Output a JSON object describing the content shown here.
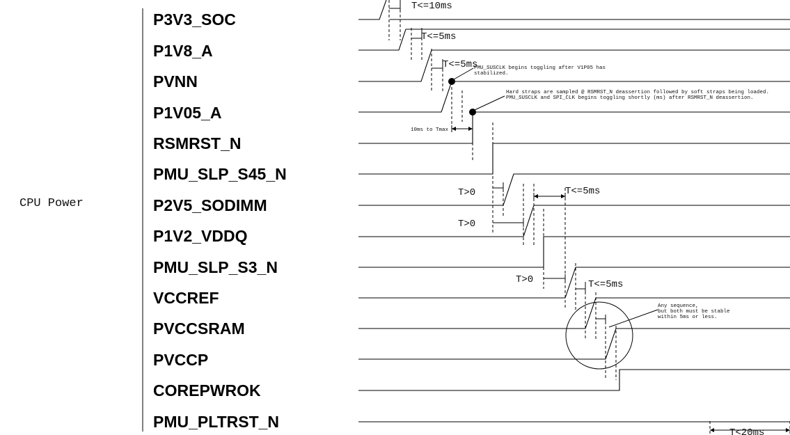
{
  "group_label": "CPU Power",
  "signals": [
    "P3V3_SOC",
    "P1V8_A",
    "PVNN",
    "P1V05_A",
    "RSMRST_N",
    "PMU_SLP_S45_N",
    "P2V5_SODIMM",
    "P1V2_VDDQ",
    "PMU_SLP_S3_N",
    "VCCREF",
    "PVCCSRAM",
    "PVCCP",
    "COREPWROK",
    "PMU_PLTRST_N"
  ],
  "timing_labels": {
    "t1": "T<=10ms",
    "t2": "T<=5ms",
    "t3": "T<=5ms",
    "t4": "10ms to Tmax",
    "t5": "T>0",
    "t6": "T<=5ms",
    "t7": "T>0",
    "t8": "T>0",
    "t9": "T<=5ms",
    "t10": "T<20ms"
  },
  "annotations": {
    "susclk_1": "PMU_SUSCLK begins toggling after V1P05 has",
    "susclk_2": "stabilized.",
    "straps_1": "Hard straps are sampled @ RSMRST_N deassertion followed by soft straps being loaded.",
    "straps_2": "PMU_SUSCLK and SPI_CLK begins toggling shortly (ms) after RSMRST_N deassertion.",
    "any_1": "Any sequence,",
    "any_2": "but both must be stable",
    "any_3": "within 5ms or less."
  }
}
